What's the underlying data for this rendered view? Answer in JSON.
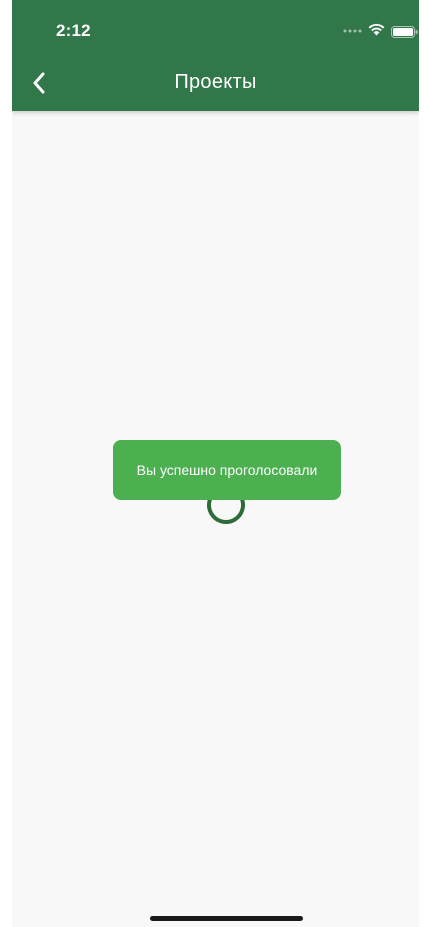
{
  "status_bar": {
    "time": "2:12"
  },
  "nav": {
    "title": "Проекты",
    "back_icon": "chevron-left-icon"
  },
  "toast": {
    "message": "Вы успешно проголосовали"
  },
  "colors": {
    "header": "#31774a",
    "toast": "#4caf50",
    "spinner": "#2e6b3a",
    "background": "#f8f8f8"
  }
}
